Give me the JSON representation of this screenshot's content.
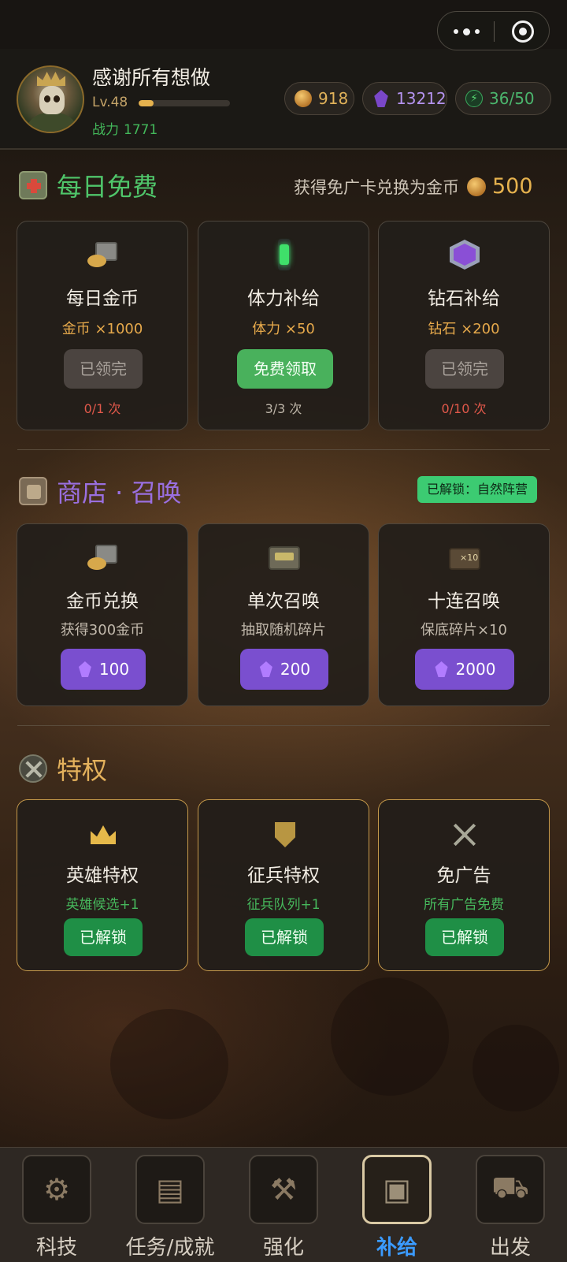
{
  "header": {
    "username": "感谢所有想做",
    "level": "Lv.48",
    "xp_fraction": 0.16,
    "power_label": "战力",
    "power_value": "1771",
    "resources": {
      "coins": "918",
      "gems": "13212",
      "energy": "36/50"
    }
  },
  "daily": {
    "title": "每日免费",
    "note": "获得免广卡兑换为金币",
    "note_value": "500",
    "cards": [
      {
        "title": "每日金币",
        "reward": "金币 ×1000",
        "button": "已领完",
        "count": "0/1 次"
      },
      {
        "title": "体力补给",
        "reward": "体力 ×50",
        "button": "免费领取",
        "count": "3/3 次"
      },
      {
        "title": "钻石补给",
        "reward": "钻石 ×200",
        "button": "已领完",
        "count": "0/10 次"
      }
    ]
  },
  "shop": {
    "title": "商店 · 召唤",
    "badge": "已解锁：自然阵营",
    "cards": [
      {
        "title": "金币兑换",
        "desc": "获得300金币",
        "price": "100"
      },
      {
        "title": "单次召唤",
        "desc": "抽取随机碎片",
        "price": "200"
      },
      {
        "title": "十连召唤",
        "desc": "保底碎片×10",
        "price": "2000"
      }
    ]
  },
  "privilege": {
    "title": "特权",
    "cards": [
      {
        "title": "英雄特权",
        "desc": "英雄候选+1",
        "button": "已解锁"
      },
      {
        "title": "征兵特权",
        "desc": "征兵队列+1",
        "button": "已解锁"
      },
      {
        "title": "免广告",
        "desc": "所有广告免费",
        "button": "已解锁"
      }
    ]
  },
  "nav": {
    "items": [
      {
        "label": "科技",
        "icon": "gear-icon"
      },
      {
        "label": "任务/成就",
        "icon": "scroll-icon"
      },
      {
        "label": "强化",
        "icon": "hammer-icon"
      },
      {
        "label": "补给",
        "icon": "crate-icon"
      },
      {
        "label": "出发",
        "icon": "vehicle-icon"
      }
    ],
    "active_index": 3
  },
  "colors": {
    "accent_green": "#49b15c",
    "accent_purple": "#7a4fcf",
    "gold": "#e0b25a",
    "active_nav": "#3b9bff"
  }
}
